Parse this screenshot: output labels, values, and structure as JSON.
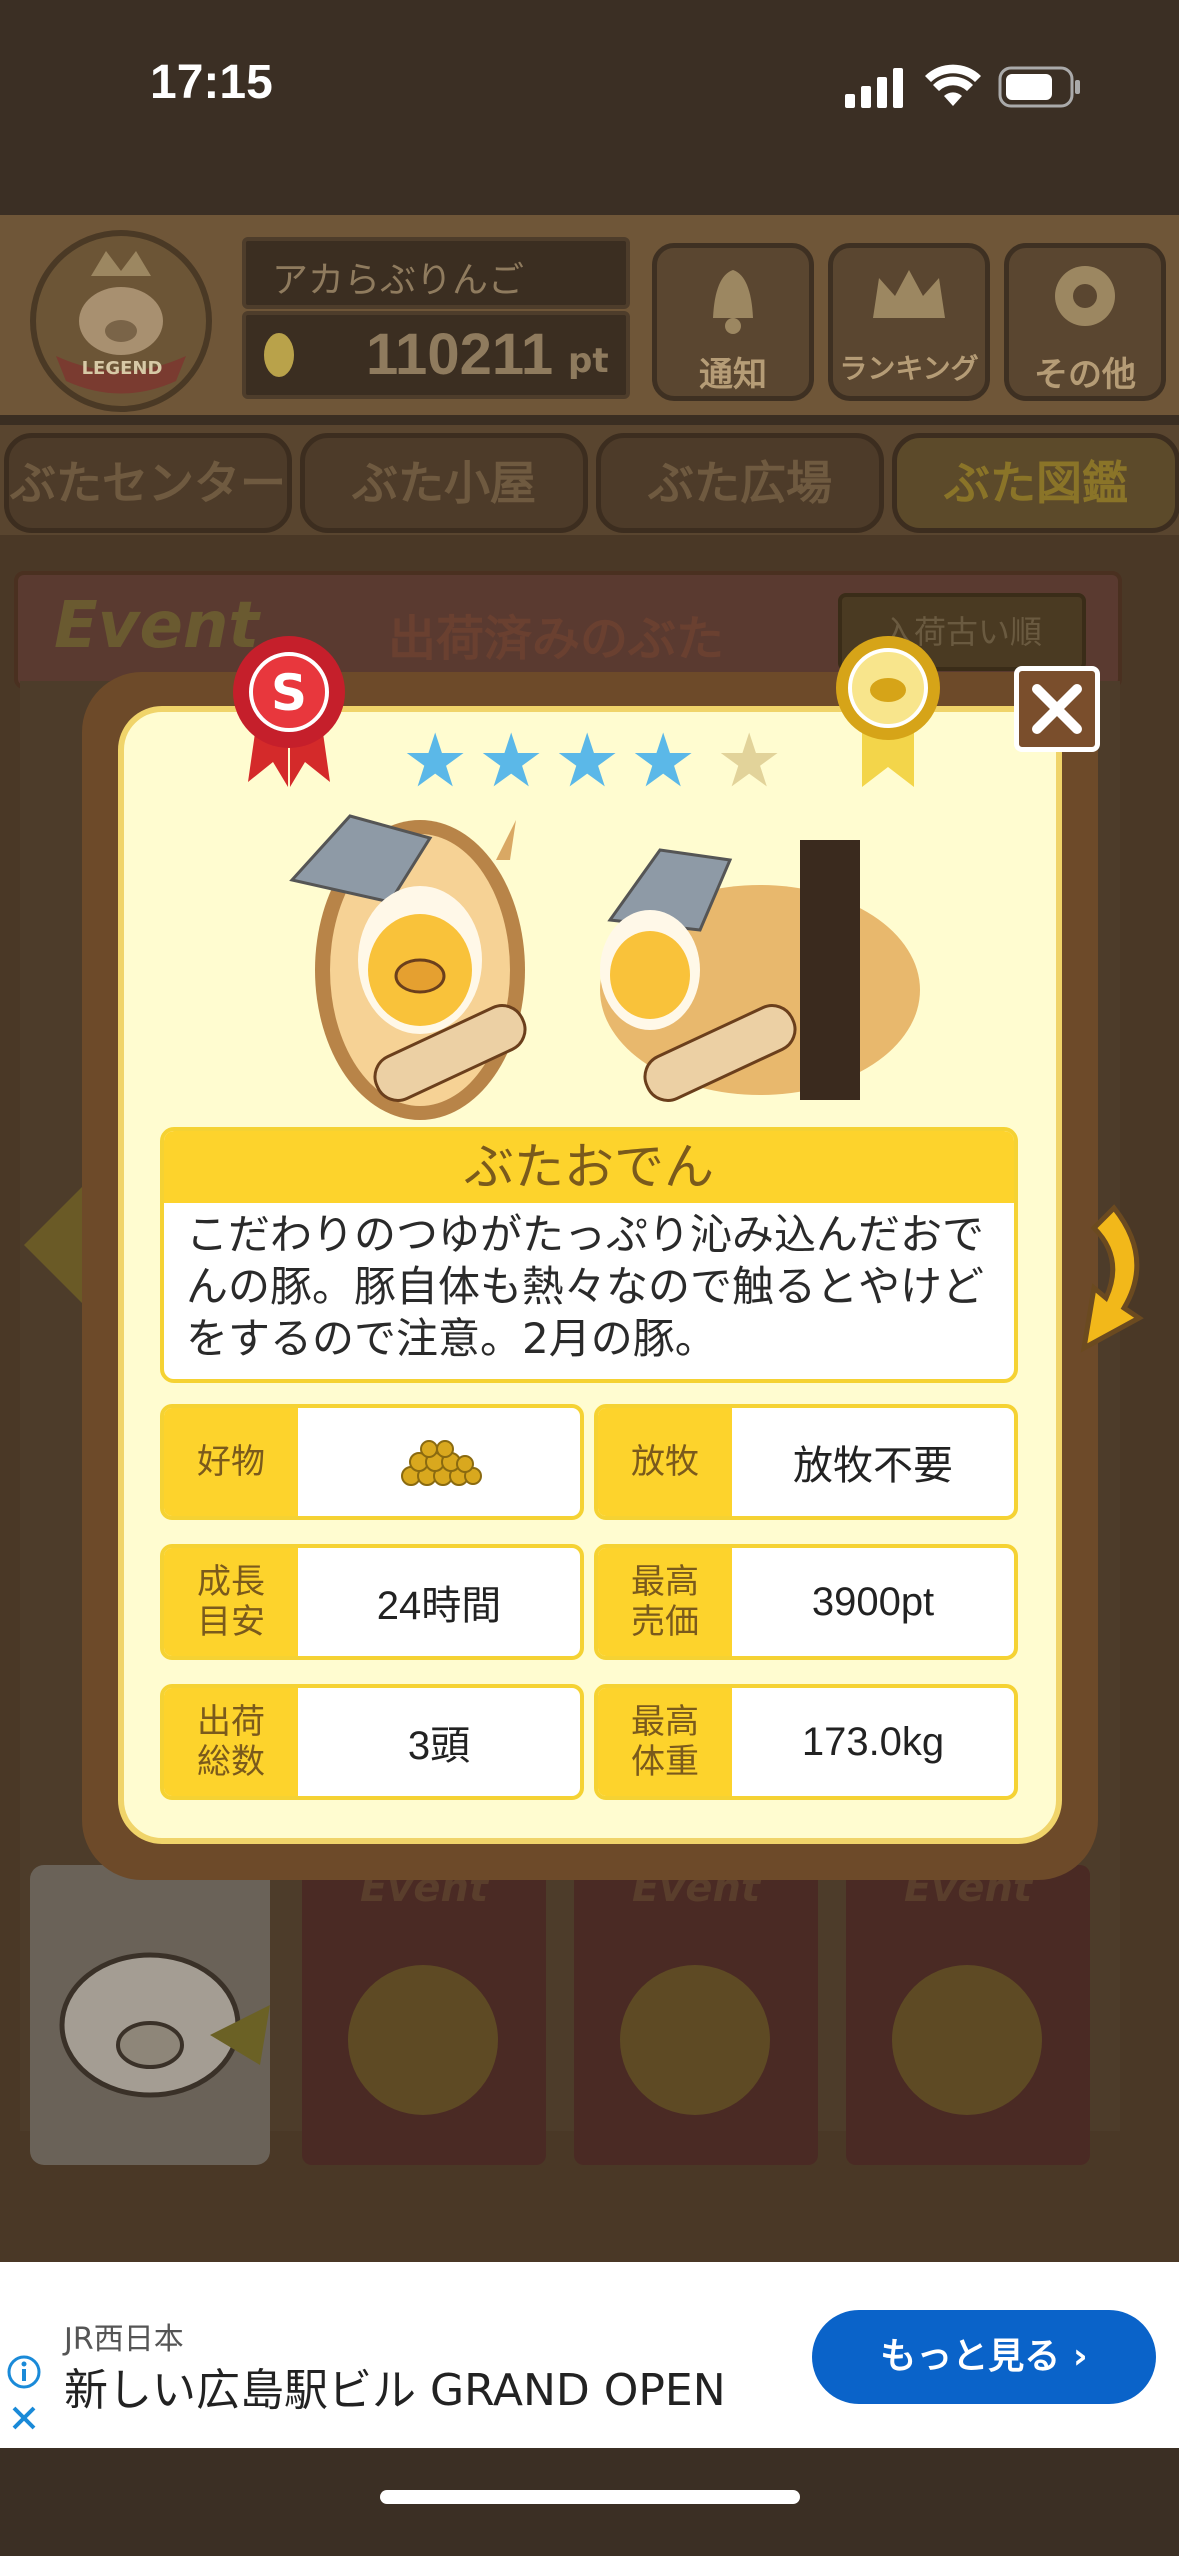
{
  "status_bar": {
    "time": "17:15"
  },
  "header": {
    "player_name": "アカらぶりんご",
    "points": "110211",
    "points_unit": "pt",
    "badge_label": "LEGEND",
    "buttons": [
      "通知",
      "ランキング",
      "その他"
    ]
  },
  "nav_tabs": [
    "ぶたセンター",
    "ぶた小屋",
    "ぶた広場",
    "ぶた図鑑"
  ],
  "sub_header": {
    "event_label": "Event",
    "title": "出荷済みのぶた",
    "sort_button": "入荷古い順"
  },
  "modal": {
    "rank_ribbon": "S",
    "rating": 4,
    "rating_max": 5,
    "pig_name": "ぶたおでん",
    "description": "こだわりのつゆがたっぷり沁み込んだおでんの豚。豚自体も熱々なので触るとやけどをするので注意。2月の豚。",
    "stats": [
      {
        "label": "好物",
        "value": "",
        "icon": "feed-pile-icon"
      },
      {
        "label": "放牧",
        "value": "放牧不要"
      },
      {
        "label": "成長\n目安",
        "value": "24時間"
      },
      {
        "label": "最高\n売価",
        "value": "3900pt"
      },
      {
        "label": "出荷\n総数",
        "value": "3頭"
      },
      {
        "label": "最高\n体重",
        "value": "173.0kg"
      }
    ]
  },
  "bottom_tabs": [
    "Event",
    "Event",
    "Event"
  ],
  "ad": {
    "advertiser": "JR西日本",
    "headline": "新しい広島駅ビル GRAND OPEN",
    "cta": "もっと見る"
  },
  "colors": {
    "star_on": "#5bb8e8",
    "star_off": "#e2d39a",
    "label_yellow": "#fdd32c",
    "cta_blue": "#0a63c9"
  }
}
